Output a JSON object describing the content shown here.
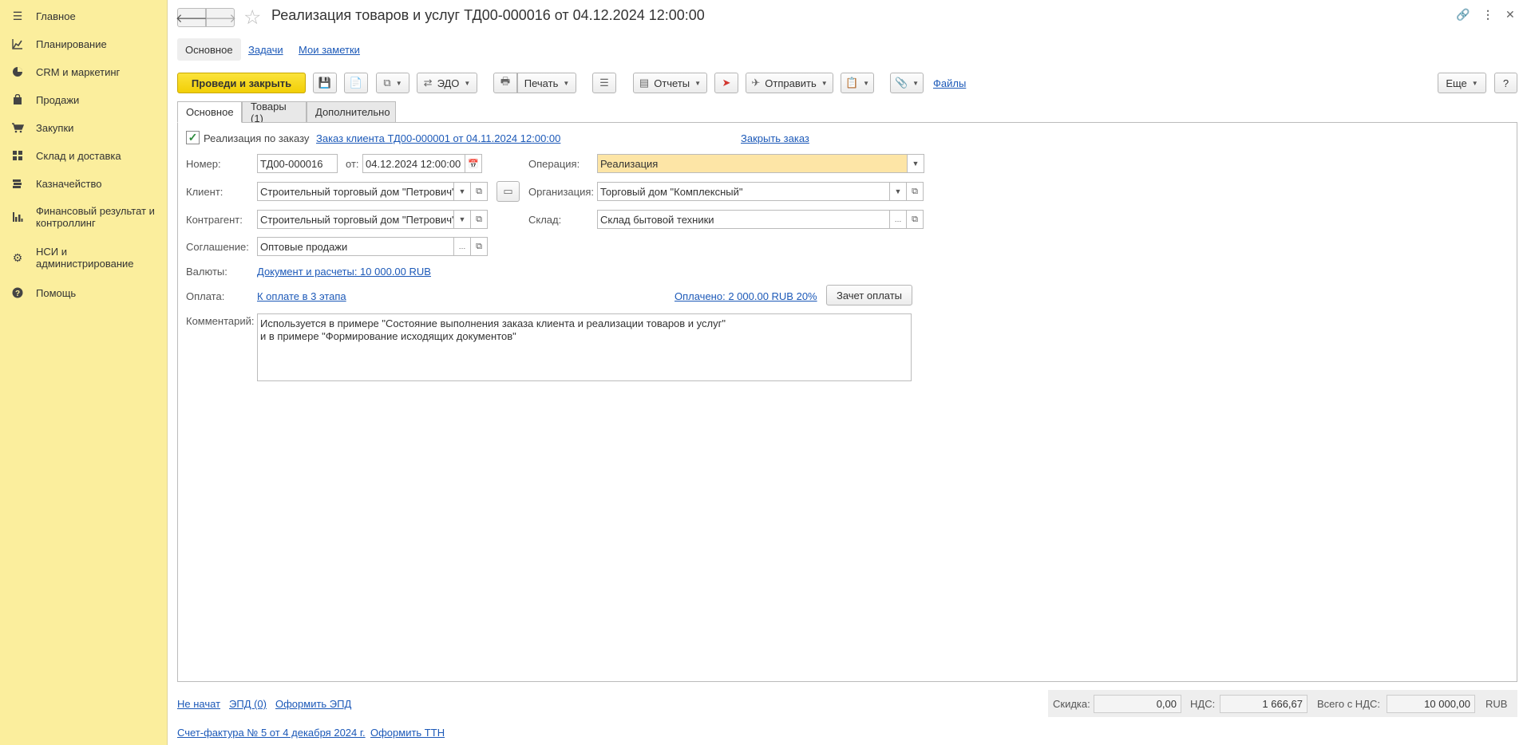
{
  "sidebar": {
    "items": [
      {
        "label": "Главное",
        "icon": "menu-icon"
      },
      {
        "label": "Планирование",
        "icon": "planning-icon"
      },
      {
        "label": "CRM и маркетинг",
        "icon": "pie-chart-icon"
      },
      {
        "label": "Продажи",
        "icon": "bag-icon"
      },
      {
        "label": "Закупки",
        "icon": "cart-icon"
      },
      {
        "label": "Склад и доставка",
        "icon": "grid-icon"
      },
      {
        "label": "Казначейство",
        "icon": "treasury-icon"
      },
      {
        "label": "Финансовый результат и контроллинг",
        "icon": "bar-chart-icon"
      },
      {
        "label": "НСИ и администрирование",
        "icon": "gear-icon"
      },
      {
        "label": "Помощь",
        "icon": "help-icon"
      }
    ]
  },
  "header": {
    "title": "Реализация товаров и услуг ТД00-000016 от 04.12.2024 12:00:00"
  },
  "topnav": {
    "main": "Основное",
    "tasks": "Задачи",
    "notes": "Мои заметки"
  },
  "toolbar": {
    "post_close": "Проведи и закрыть",
    "edo": "ЭДО",
    "print": "Печать",
    "reports": "Отчеты",
    "send": "Отправить",
    "files": "Файлы",
    "more": "Еще",
    "help": "?"
  },
  "tabs": {
    "main": "Основное",
    "goods": "Товары (1)",
    "extra": "Дополнительно"
  },
  "form": {
    "by_order_label": "Реализация по заказу",
    "order_link": "Заказ клиента ТД00-000001 от 04.11.2024 12:00:00",
    "close_order": "Закрыть заказ",
    "number_label": "Номер:",
    "number": "ТД00-000016",
    "from_label": "от:",
    "date": "04.12.2024 12:00:00",
    "operation_label": "Операция:",
    "operation": "Реализация",
    "client_label": "Клиент:",
    "client": "Строительный торговый дом \"Петрович\"",
    "org_label": "Организация:",
    "org": "Торговый дом \"Комплексный\"",
    "counterparty_label": "Контрагент:",
    "counterparty": "Строительный торговый дом \"Петрович\"",
    "warehouse_label": "Склад:",
    "warehouse": "Склад бытовой техники",
    "agreement_label": "Соглашение:",
    "agreement": "Оптовые продажи",
    "currency_label": "Валюты:",
    "currency_link": "Документ и расчеты: 10 000.00 RUB",
    "payment_label": "Оплата:",
    "payment_link": "К оплате в 3 этапа",
    "paid_link": "Оплачено: 2 000.00 RUB 20%",
    "offset_btn": "Зачет оплаты",
    "comment_label": "Комментарий:",
    "comment": "Используется в примере \"Состояние выполнения заказа клиента и реализации товаров и услуг\"\nи в примере \"Формирование исходящих документов\""
  },
  "footer": {
    "status": "Не начат",
    "epd": "ЭПД (0)",
    "make_epd": "Оформить ЭПД",
    "invoice": "Счет-фактура № 5 от 4 декабря 2024 г.",
    "make_ttn": "Оформить ТТН",
    "discount_label": "Скидка:",
    "discount": "0,00",
    "vat_label": "НДС:",
    "vat": "1 666,67",
    "total_label": "Всего с НДС:",
    "total": "10 000,00",
    "currency": "RUB"
  }
}
